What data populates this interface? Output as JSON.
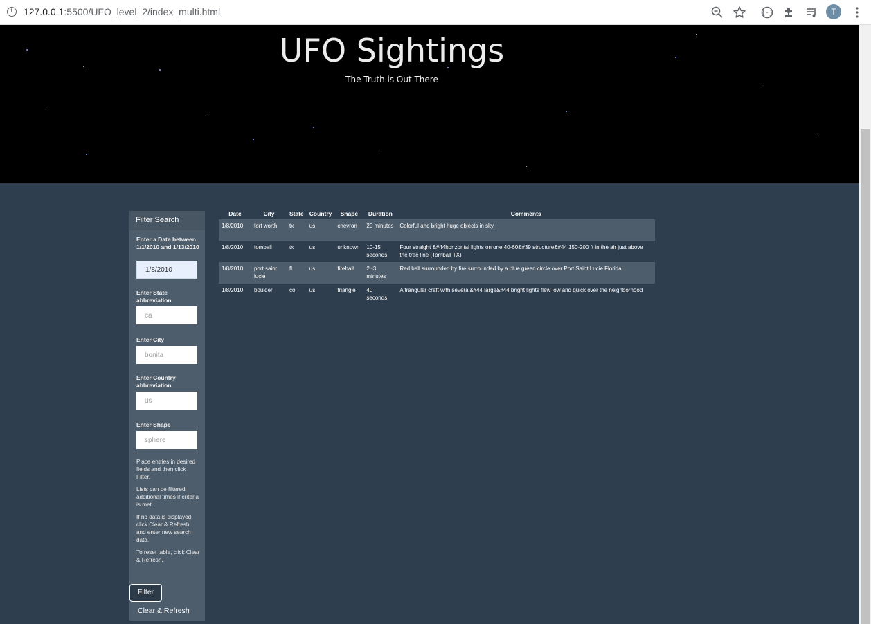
{
  "browser": {
    "url_host": "127.0.0.1",
    "url_path": ":5500/UFO_level_2/index_multi.html",
    "profile_initial": "T"
  },
  "hero": {
    "title": "UFO Sightings",
    "subtitle": "The Truth is Out There"
  },
  "filter": {
    "heading": "Filter Search",
    "date_label": "Enter a Date between 1/1/2010 and 1/13/2010",
    "date_value": "1/8/2010",
    "state_label": "Enter State abbreviation",
    "state_placeholder": "ca",
    "city_label": "Enter City",
    "city_placeholder": "bonita",
    "country_label": "Enter Country abbreviation",
    "country_placeholder": "us",
    "shape_label": "Enter Shape",
    "shape_placeholder": "sphere",
    "notes": [
      "Place entries in desired fields and then click Filter.",
      "Lists can be filtered additional times if criteria is met.",
      "If no data is displayed, click Clear & Refresh and enter new search data.",
      "To reset table, click Clear & Refresh."
    ],
    "filter_button": "Filter",
    "clear_button": "Clear & Refresh"
  },
  "table": {
    "headers": [
      "Date",
      "City",
      "State",
      "Country",
      "Shape",
      "Duration",
      "Comments"
    ],
    "rows": [
      [
        "1/8/2010",
        "fort worth",
        "tx",
        "us",
        "chevron",
        "20 minutes",
        "Colorful and bright huge objects in sky."
      ],
      [
        "1/8/2010",
        "tomball",
        "tx",
        "us",
        "unknown",
        "10-15 seconds",
        "Four straight &#44horizontal lights on one 40-60&#39 structure&#44 150-200 ft in the air just above the tree line (Tomball TX)"
      ],
      [
        "1/8/2010",
        "port saint lucie",
        "fl",
        "us",
        "fireball",
        "2 -3 minutes",
        "Red ball surrounded by fire surrounded by a blue green circle over Port Saint Lucie Florida"
      ],
      [
        "1/8/2010",
        "boulder",
        "co",
        "us",
        "triangle",
        "40 seconds",
        "A trangular craft with several&#44 large&#44 bright lights flew low and quick over the neighborhood"
      ]
    ]
  }
}
